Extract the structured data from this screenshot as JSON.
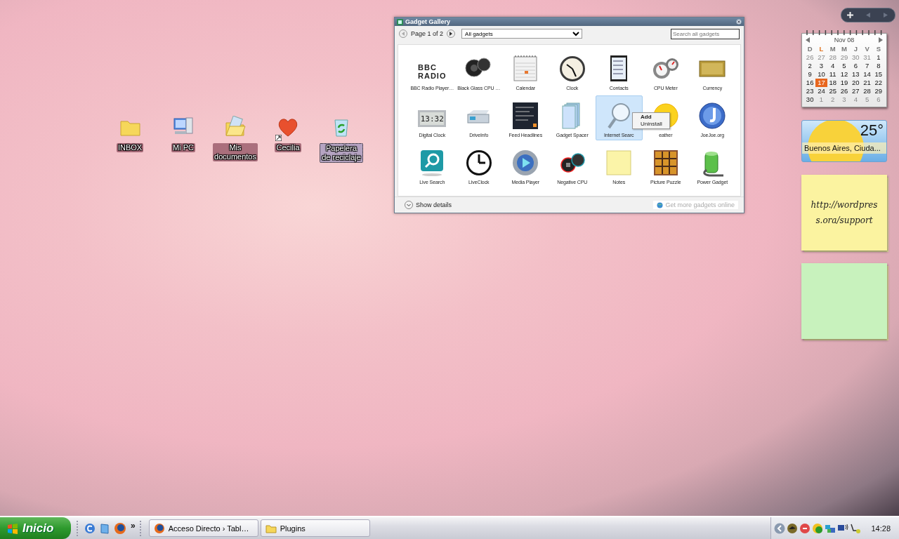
{
  "desktop_icons": [
    {
      "label": "INBOX",
      "selected": false,
      "shortcut": false
    },
    {
      "label": "Mi PC",
      "selected": false,
      "shortcut": false
    },
    {
      "label": "Mis documentos",
      "selected": false,
      "shortcut": false
    },
    {
      "label": "Cecilia",
      "selected": false,
      "shortcut": true
    },
    {
      "label": "Papelera de reciclaje",
      "selected": true,
      "shortcut": false
    }
  ],
  "gadget_gallery": {
    "title": "Gadget Gallery",
    "page": "Page 1 of 2",
    "filter": "All gadgets",
    "search": {
      "placeholder": "Search all gadgets"
    },
    "gadgets": [
      {
        "label": "BBC Radio Player…",
        "selected": false,
        "icon_text": [
          "BBC",
          "RADIO"
        ]
      },
      {
        "label": "Black Glass CPU …",
        "selected": false
      },
      {
        "label": "Calendar",
        "selected": false
      },
      {
        "label": "Clock",
        "selected": false
      },
      {
        "label": "Contacts",
        "selected": false
      },
      {
        "label": "CPU Meter",
        "selected": false
      },
      {
        "label": "Currency",
        "selected": false
      },
      {
        "label": "Digital Clock",
        "selected": false,
        "icon_text": [
          "13:32"
        ]
      },
      {
        "label": "DriveInfo",
        "selected": false
      },
      {
        "label": "Feed Headlines",
        "selected": false
      },
      {
        "label": "Gadget Spacer",
        "selected": false
      },
      {
        "label": "Internet Searc",
        "selected": true
      },
      {
        "label": "eather",
        "selected": false
      },
      {
        "label": "JoeJoe.org",
        "selected": false
      },
      {
        "label": "Live Search",
        "selected": false
      },
      {
        "label": "LiveClock",
        "selected": false
      },
      {
        "label": "Media Player",
        "selected": false
      },
      {
        "label": "Negative CPU",
        "selected": false
      },
      {
        "label": "Notes",
        "selected": false
      },
      {
        "label": "Picture Puzzle",
        "selected": false
      },
      {
        "label": "Power Gadget",
        "selected": false
      }
    ],
    "context_menu": [
      {
        "label": "Add",
        "default": true
      },
      {
        "label": "Uninstall",
        "default": false
      }
    ],
    "details": "Show details",
    "online_link": {
      "label": "Get more gadgets online",
      "disabled": true
    }
  },
  "sidebar": {
    "calendar": {
      "month": "Nov 08",
      "weekdays": [
        {
          "label": "D",
          "today": false
        },
        {
          "label": "L",
          "today": true
        },
        {
          "label": "M",
          "today": false
        },
        {
          "label": "M",
          "today": false
        },
        {
          "label": "J",
          "today": false
        },
        {
          "label": "V",
          "today": false
        },
        {
          "label": "S",
          "today": false
        }
      ],
      "weeks": [
        [
          {
            "day": "26",
            "muted": true,
            "today": false
          },
          {
            "day": "27",
            "muted": true,
            "today": false
          },
          {
            "day": "28",
            "muted": true,
            "today": false
          },
          {
            "day": "29",
            "muted": true,
            "today": false
          },
          {
            "day": "30",
            "muted": true,
            "today": false
          },
          {
            "day": "31",
            "muted": true,
            "today": false
          },
          {
            "day": "1",
            "muted": false,
            "today": false
          }
        ],
        [
          {
            "day": "2",
            "muted": false,
            "today": false
          },
          {
            "day": "3",
            "muted": false,
            "today": false
          },
          {
            "day": "4",
            "muted": false,
            "today": false
          },
          {
            "day": "5",
            "muted": false,
            "today": false
          },
          {
            "day": "6",
            "muted": false,
            "today": false
          },
          {
            "day": "7",
            "muted": false,
            "today": false
          },
          {
            "day": "8",
            "muted": false,
            "today": false
          }
        ],
        [
          {
            "day": "9",
            "muted": false,
            "today": false
          },
          {
            "day": "10",
            "muted": false,
            "today": false
          },
          {
            "day": "11",
            "muted": false,
            "today": false
          },
          {
            "day": "12",
            "muted": false,
            "today": false
          },
          {
            "day": "13",
            "muted": false,
            "today": false
          },
          {
            "day": "14",
            "muted": false,
            "today": false
          },
          {
            "day": "15",
            "muted": false,
            "today": false
          }
        ],
        [
          {
            "day": "16",
            "muted": false,
            "today": false
          },
          {
            "day": "17",
            "muted": false,
            "today": true
          },
          {
            "day": "18",
            "muted": false,
            "today": false
          },
          {
            "day": "19",
            "muted": false,
            "today": false
          },
          {
            "day": "20",
            "muted": false,
            "today": false
          },
          {
            "day": "21",
            "muted": false,
            "today": false
          },
          {
            "day": "22",
            "muted": false,
            "today": false
          }
        ],
        [
          {
            "day": "23",
            "muted": false,
            "today": false
          },
          {
            "day": "24",
            "muted": false,
            "today": false
          },
          {
            "day": "25",
            "muted": false,
            "today": false
          },
          {
            "day": "26",
            "muted": false,
            "today": false
          },
          {
            "day": "27",
            "muted": false,
            "today": false
          },
          {
            "day": "28",
            "muted": false,
            "today": false
          },
          {
            "day": "29",
            "muted": false,
            "today": false
          }
        ],
        [
          {
            "day": "30",
            "muted": false,
            "today": false
          },
          {
            "day": "1",
            "muted": true,
            "today": false
          },
          {
            "day": "2",
            "muted": true,
            "today": false
          },
          {
            "day": "3",
            "muted": true,
            "today": false
          },
          {
            "day": "4",
            "muted": true,
            "today": false
          },
          {
            "day": "5",
            "muted": true,
            "today": false
          },
          {
            "day": "6",
            "muted": true,
            "today": false
          }
        ]
      ]
    },
    "weather": {
      "temperature": "25°",
      "location": "Buenos Aires, Ciuda..."
    },
    "notes": [
      {
        "text": "http://wordpress.ora/support",
        "color": "#fbf3a0"
      },
      {
        "color": "#c8f2bd"
      }
    ]
  },
  "taskbar": {
    "start": "Inicio",
    "more": "»",
    "tasks": [
      {
        "label": "Acceso Directo › Tabl…",
        "selected": false
      },
      {
        "label": "Plugins",
        "selected": false
      }
    ],
    "clock": "14:28"
  }
}
